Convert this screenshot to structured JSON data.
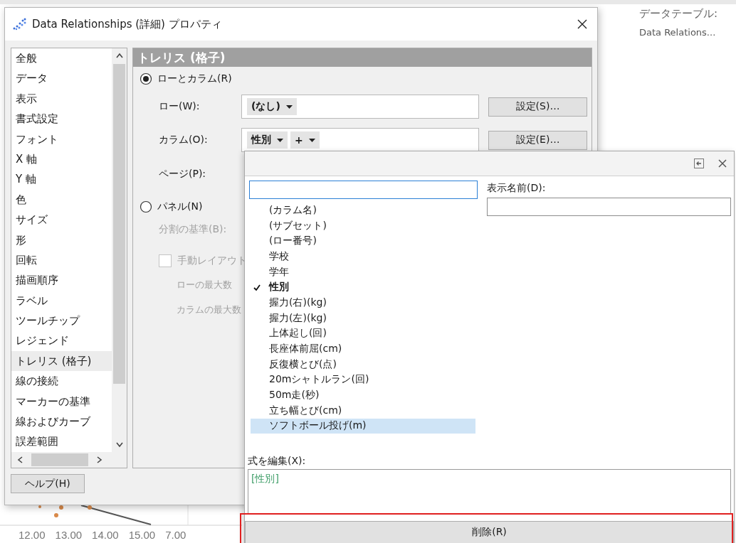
{
  "background": {
    "data_table_label": "データテーブル:",
    "data_table_name": "Data Relations...",
    "axis_labels": [
      "12.00",
      "13.00",
      "14.00",
      "15.00",
      "7.00"
    ]
  },
  "dialog": {
    "title": "Data Relationships (詳細) プロパティ",
    "categories": [
      {
        "label": "全般",
        "selected": false
      },
      {
        "label": "データ",
        "selected": false
      },
      {
        "label": "表示",
        "selected": false
      },
      {
        "label": "書式設定",
        "selected": false
      },
      {
        "label": "フォント",
        "selected": false
      },
      {
        "label": "X 軸",
        "selected": false
      },
      {
        "label": "Y 軸",
        "selected": false
      },
      {
        "label": "色",
        "selected": false
      },
      {
        "label": "サイズ",
        "selected": false
      },
      {
        "label": "形",
        "selected": false
      },
      {
        "label": "回転",
        "selected": false
      },
      {
        "label": "描画順序",
        "selected": false
      },
      {
        "label": "ラベル",
        "selected": false
      },
      {
        "label": "ツールチップ",
        "selected": false
      },
      {
        "label": "レジェンド",
        "selected": false
      },
      {
        "label": "トレリス (格子)",
        "selected": true
      },
      {
        "label": "線の接続",
        "selected": false
      },
      {
        "label": "マーカーの基準",
        "selected": false
      },
      {
        "label": "線およびカーブ",
        "selected": false
      },
      {
        "label": "誤差範囲",
        "selected": false
      }
    ],
    "help_button": "ヘルプ(H)",
    "panel": {
      "header": "トレリス (格子)",
      "row_column_option": {
        "label": "ローとカラム(R)",
        "selected": true
      },
      "row": {
        "label": "ロー(W):",
        "tokens": [
          {
            "text": "(なし)"
          }
        ],
        "button": "設定(S)…"
      },
      "column": {
        "label": "カラム(O):",
        "tokens": [
          {
            "text": "性別"
          },
          {
            "text": "+"
          }
        ],
        "button": "設定(E)…"
      },
      "page": {
        "label": "ページ(P):"
      },
      "panel_option": {
        "label": "パネル(N)",
        "selected": false
      },
      "split_by": {
        "label": "分割の基準(B):",
        "disabled": true
      },
      "manual_layout": {
        "label": "手動レイアウト",
        "checked": false,
        "disabled": true
      },
      "max_rows": {
        "label": "ローの最大数",
        "disabled": true
      },
      "max_columns": {
        "label": "カラムの最大数",
        "disabled": true
      }
    }
  },
  "column_picker": {
    "columns": [
      {
        "label": "(カラム名)",
        "checked": false,
        "selected": false
      },
      {
        "label": "(サブセット)",
        "checked": false,
        "selected": false
      },
      {
        "label": "(ロー番号)",
        "checked": false,
        "selected": false
      },
      {
        "label": "学校",
        "checked": false,
        "selected": false
      },
      {
        "label": "学年",
        "checked": false,
        "selected": false
      },
      {
        "label": "性別",
        "checked": true,
        "selected": false
      },
      {
        "label": "握力(右)(kg)",
        "checked": false,
        "selected": false
      },
      {
        "label": "握力(左)(kg)",
        "checked": false,
        "selected": false
      },
      {
        "label": "上体起し(回)",
        "checked": false,
        "selected": false
      },
      {
        "label": "長座体前屈(cm)",
        "checked": false,
        "selected": false
      },
      {
        "label": "反復横とび(点)",
        "checked": false,
        "selected": false
      },
      {
        "label": "20mシャトルラン(回)",
        "checked": false,
        "selected": false
      },
      {
        "label": "50m走(秒)",
        "checked": false,
        "selected": false
      },
      {
        "label": "立ち幅とび(cm)",
        "checked": false,
        "selected": false
      },
      {
        "label": "ソフトボール投げ(m)",
        "checked": false,
        "selected": true
      }
    ],
    "display_name": {
      "label": "表示名前(D):"
    },
    "expression": {
      "label": "式を編集(X):",
      "value": "[性別]"
    },
    "delete_button": "削除(R)"
  }
}
